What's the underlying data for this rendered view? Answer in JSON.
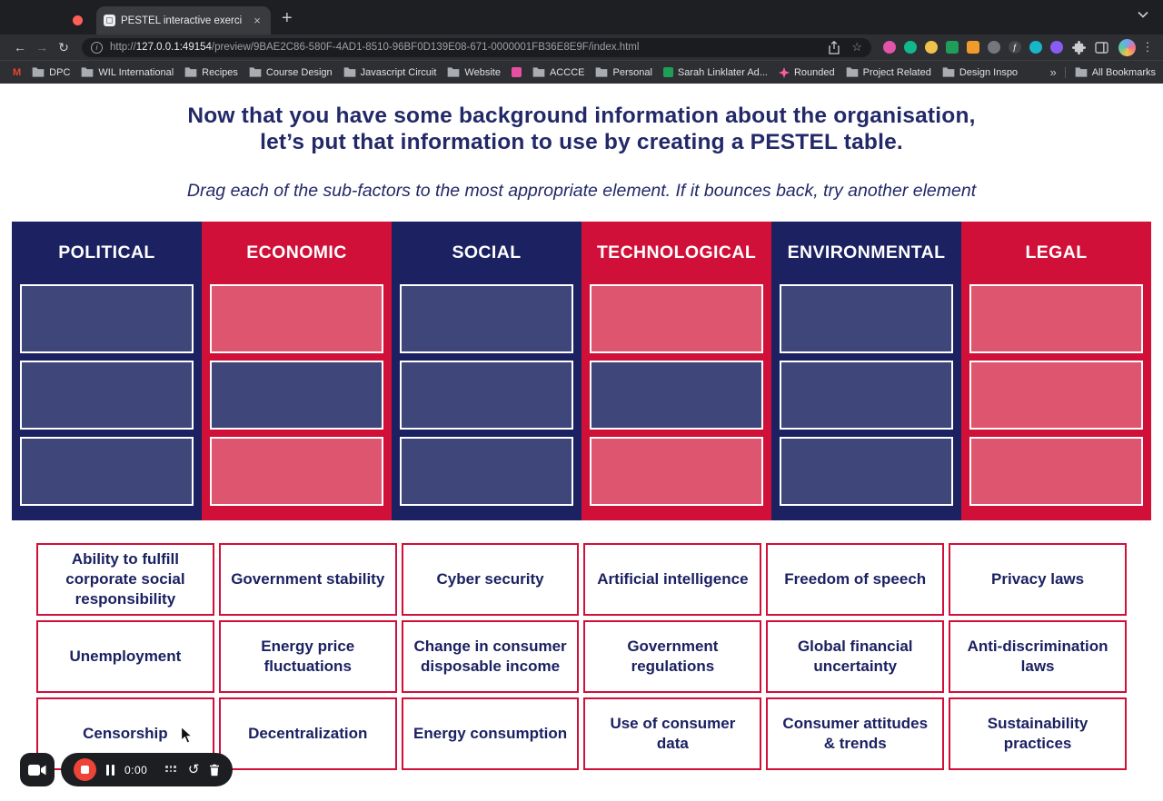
{
  "colors": {
    "navy": "#1b2161",
    "navyCell": "#3f4679",
    "red": "#d01039",
    "redCell": "#dd556e",
    "headingText": "#232968",
    "chipBorder": "#d01039",
    "chipText": "#1b2161",
    "chromeBg": "#1e1f22",
    "tabActiveBg": "#3a3b3f",
    "toolbarBg": "#2e2f33",
    "pillBg": "#1b1c1f",
    "chromeDim": "#9aa0a6",
    "recorderBg": "#1d1e21",
    "recorderStop": "#ee4437",
    "windowDot": "#ff5f57"
  },
  "browser": {
    "tab": {
      "title": "PESTEL interactive exerci"
    },
    "icons": {
      "back": "←",
      "forward": "→",
      "reload": "↻",
      "close": "×",
      "new_tab": "+",
      "star": "☆",
      "kebab": "⋮",
      "info": "i",
      "overflow": "»",
      "restart": "↺"
    },
    "address": {
      "scheme": "http://",
      "host": "127.0.0.1:49154",
      "path": "/preview/9BAE2C86-580F-4AD1-8510-96BF0D139E08-671-0000001FB36E8E9F/index.html"
    },
    "bookmarks": [
      {
        "icon": "gmail",
        "label": ""
      },
      {
        "icon": "folder",
        "label": "DPC"
      },
      {
        "icon": "folder",
        "label": "WIL International"
      },
      {
        "icon": "folder",
        "label": "Recipes"
      },
      {
        "icon": "folder",
        "label": "Course Design"
      },
      {
        "icon": "folder",
        "label": "Javascript Circuit"
      },
      {
        "icon": "folder",
        "label": "Website"
      },
      {
        "icon": "pink",
        "label": ""
      },
      {
        "icon": "folder",
        "label": "ACCCE"
      },
      {
        "icon": "folder",
        "label": "Personal"
      },
      {
        "icon": "sheets",
        "label": "Sarah Linklater Ad..."
      },
      {
        "icon": "star",
        "label": "Rounded"
      },
      {
        "icon": "folder",
        "label": "Project Related"
      },
      {
        "icon": "folder",
        "label": "Design Inspo"
      }
    ],
    "all_bookmarks": "All Bookmarks",
    "extensions": [
      {
        "name": "pink-flower-extension-icon",
        "color": "#e254a7",
        "shape": "circle"
      },
      {
        "name": "grammarly-extension-icon",
        "color": "#0fb98c",
        "shape": "circle"
      },
      {
        "name": "pencil-extension-icon",
        "color": "#f0c24b",
        "shape": "circle"
      },
      {
        "name": "spreadsheet-extension-icon",
        "color": "#1f9e5a",
        "shape": "square"
      },
      {
        "name": "orange-extension-icon",
        "color": "#f29b2d",
        "shape": "square"
      },
      {
        "name": "gray-dot-extension-icon",
        "color": "#74787e",
        "shape": "circle"
      },
      {
        "name": "function-extension-icon",
        "color": "#44464b",
        "shape": "circle",
        "glyph": "ƒ"
      },
      {
        "name": "teal-extension-icon",
        "color": "#18b6c9",
        "shape": "circle"
      },
      {
        "name": "purple-layers-extension-icon",
        "color": "#8a5cf6",
        "shape": "circle"
      }
    ]
  },
  "page": {
    "heading_line1": "Now that you have some background information about the organisation,",
    "heading_line2": "let’s put that information to use by creating a PESTEL table.",
    "instruction": "Drag each of the sub-factors to the most appropriate element. If it bounces back, try another element"
  },
  "pestel": {
    "columns": [
      {
        "name": "POLITICAL",
        "theme": "navy",
        "slots": [
          "navy",
          "navy",
          "navy"
        ]
      },
      {
        "name": "ECONOMIC",
        "theme": "red",
        "slots": [
          "red",
          "navy",
          "red"
        ]
      },
      {
        "name": "SOCIAL",
        "theme": "navy",
        "slots": [
          "navy",
          "navy",
          "navy"
        ]
      },
      {
        "name": "TECHNOLOGICAL",
        "theme": "red",
        "slots": [
          "red",
          "navy",
          "red"
        ]
      },
      {
        "name": "ENVIRONMENTAL",
        "theme": "navy",
        "slots": [
          "navy",
          "navy",
          "navy"
        ]
      },
      {
        "name": "LEGAL",
        "theme": "red",
        "slots": [
          "red",
          "red",
          "red"
        ]
      }
    ]
  },
  "chips": [
    "Ability to fulfill corporate social responsibility",
    "Government stability",
    "Cyber security",
    "Artificial intelligence",
    "Freedom of speech",
    "Privacy laws",
    "Unemployment",
    "Energy price fluctuations",
    "Change in consumer disposable income",
    "Government regulations",
    "Global financial uncertainty",
    "Anti-discrimination laws",
    "Censorship",
    "Decentralization",
    "Energy consumption",
    "Use of consumer data",
    "Consumer attitudes & trends",
    "Sustainability practices"
  ],
  "recorder": {
    "time": "0:00"
  }
}
